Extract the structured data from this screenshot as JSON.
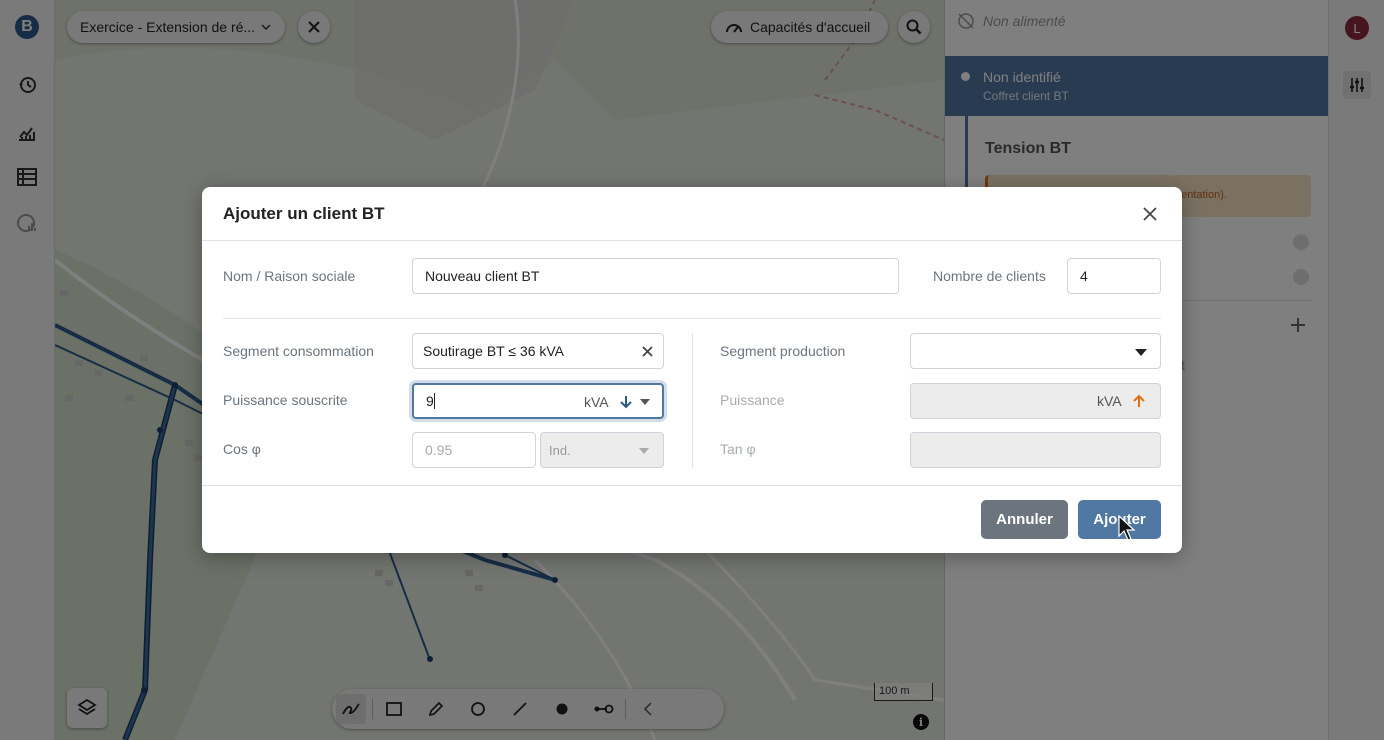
{
  "header": {
    "exercise_select": "Exercice - Extension de ré...",
    "capacities_label": "Capacités d'accueil"
  },
  "left_rail": {
    "logo": "B"
  },
  "map": {
    "scale_label": "100 m"
  },
  "panel": {
    "top_status": "Non alimenté",
    "selected_title": "Non identifié",
    "selected_subtitle": "Coffret client BT",
    "section_title": "Tension BT",
    "warning_text": "...entation).",
    "partial_text": "t"
  },
  "right_rail": {
    "avatar": "L"
  },
  "modal": {
    "title": "Ajouter un client BT",
    "name_label": "Nom / Raison sociale",
    "name_value": "Nouveau client BT",
    "clients_label": "Nombre de clients",
    "clients_value": "4",
    "segment_cons_label": "Segment consommation",
    "segment_cons_value": "Soutirage BT ≤ 36 kVA",
    "power_label": "Puissance souscrite",
    "power_value": "9",
    "power_unit": "kVA",
    "cos_label": "Cos φ",
    "cos_placeholder": "0.95",
    "cos_type": "Ind.",
    "segment_prod_label": "Segment production",
    "segment_prod_value": "",
    "prod_power_label": "Puissance",
    "prod_power_unit": "kVA",
    "tan_label": "Tan φ",
    "cancel_label": "Annuler",
    "submit_label": "Ajouter"
  },
  "colors": {
    "primary": "#5177a3",
    "network_line": "#2e5a8a",
    "producer_arrow": "#e0700f",
    "warning_bg": "#f5e2c4",
    "avatar": "#8e2a3f"
  }
}
